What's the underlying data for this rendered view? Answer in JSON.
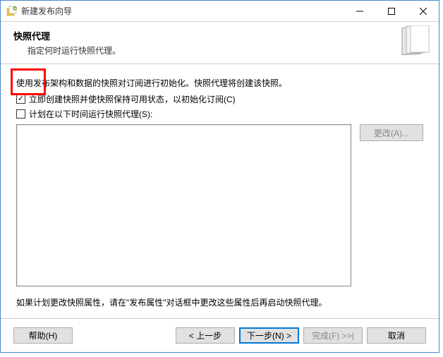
{
  "window": {
    "title": "新建发布向导"
  },
  "header": {
    "title": "快照代理",
    "subtitle": "指定何时运行快照代理。"
  },
  "content": {
    "intro": "使用发布架构和数据的快照对订阅进行初始化。快照代理将创建该快照。",
    "checkbox1_label": "立即创建快照并使快照保持可用状态，以初始化订阅(C)",
    "checkbox1_checked": true,
    "checkbox2_label": "计划在以下时间运行快照代理(S):",
    "checkbox2_checked": false,
    "change_button": "更改(A)...",
    "note": "如果计划更改快照属性，请在\"发布属性\"对话框中更改这些属性后再启动快照代理。"
  },
  "footer": {
    "help": "帮助(H)",
    "back": "< 上一步",
    "next": "下一步(N) >",
    "finish": "完成(F) >>|",
    "cancel": "取消"
  }
}
